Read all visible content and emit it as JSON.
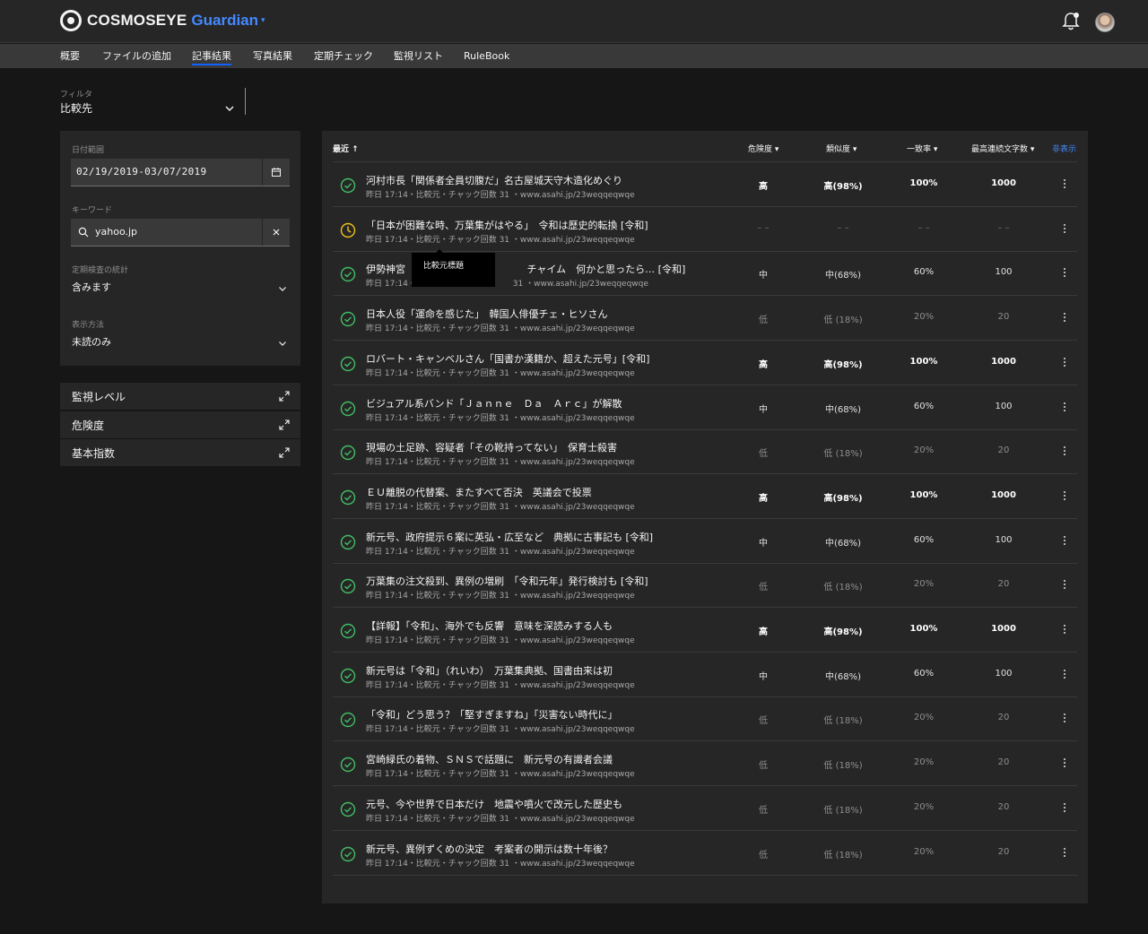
{
  "header": {
    "brand": "COSMOSEYE",
    "product": "Guardian",
    "product_caret": "▾"
  },
  "nav": {
    "items": [
      {
        "label": "概要",
        "active": false
      },
      {
        "label": "ファイルの追加",
        "active": false
      },
      {
        "label": "記事結果",
        "active": true
      },
      {
        "label": "写真結果",
        "active": false
      },
      {
        "label": "定期チェック",
        "active": false
      },
      {
        "label": "監視リスト",
        "active": false
      },
      {
        "label": "RuleBook",
        "active": false
      }
    ]
  },
  "filter": {
    "label": "フィルタ",
    "value": "比較先"
  },
  "filter_card": {
    "date_label": "日付範囲",
    "date_value": "02/19/2019-03/07/2019",
    "keyword_label": "キーワード",
    "keyword_value": "yahoo.jp",
    "stats_label": "定期検査の統計",
    "stats_value": "含みます",
    "display_label": "表示方法",
    "display_value": "未読のみ"
  },
  "accordions": [
    "監視レベル",
    "危険度",
    "基本指数"
  ],
  "table": {
    "col_recent": "最近 ↑",
    "col_risk": "危険度 ▾",
    "col_similarity": "類似度 ▾",
    "col_match": "一致率 ▾",
    "col_maxchars": "最高連続文字数 ▾",
    "hide": "非表示",
    "tooltip": "比較元標題",
    "rows": [
      {
        "status": "done",
        "title": "河村市長「関係者全員切腹だ」名古屋城天守木造化めぐり",
        "meta": "昨日 17:14・比較元・チャック回数 31 ・www.asahi.jp/23weqqeqwqe",
        "risk": "高",
        "similarity": "高(98%)",
        "match": "100%",
        "maxchars": "1000",
        "level": "hi"
      },
      {
        "status": "pending",
        "title": "「日本が困難な時、万葉集がはやる」　令和は歴史的転換 [令和]",
        "meta": "昨日 17:14・比較元・チャック回数 31 ・www.asahi.jp/23weqqeqwqe",
        "risk": "– –",
        "similarity": "– –",
        "match": "– –",
        "maxchars": "– –",
        "level": "na"
      },
      {
        "status": "done",
        "title": "伊勢神宮 　　　　　　　　　　　　チャイム　何かと思ったら… [令和]",
        "meta": "昨日 17:14・　　　　　　　　　　　　31 ・www.asahi.jp/23weqqeqwqe",
        "risk": "中",
        "similarity": "中(68%)",
        "match": "60%",
        "maxchars": "100",
        "level": "md"
      },
      {
        "status": "done",
        "title": "日本人役「運命を感じた」　韓国人俳優チェ・ヒソさん",
        "meta": "昨日 17:14・比較元・チャック回数 31 ・www.asahi.jp/23weqqeqwqe",
        "risk": "低",
        "similarity": "低 (18%)",
        "match": "20%",
        "maxchars": "20",
        "level": "lo"
      },
      {
        "status": "done",
        "title": "ロバート・キャンベルさん「国書か漢籍か、超えた元号」[令和]",
        "meta": "昨日 17:14・比較元・チャック回数 31 ・www.asahi.jp/23weqqeqwqe",
        "risk": "高",
        "similarity": "高(98%)",
        "match": "100%",
        "maxchars": "1000",
        "level": "hi"
      },
      {
        "status": "done",
        "title": "ビジュアル系バンド「Ｊａｎｎｅ　Ｄａ　Ａｒｃ」が解散",
        "meta": "昨日 17:14・比較元・チャック回数 31 ・www.asahi.jp/23weqqeqwqe",
        "risk": "中",
        "similarity": "中(68%)",
        "match": "60%",
        "maxchars": "100",
        "level": "md"
      },
      {
        "status": "done",
        "title": "現場の土足跡、容疑者「その靴持ってない」　保育士殺害",
        "meta": "昨日 17:14・比較元・チャック回数 31 ・www.asahi.jp/23weqqeqwqe",
        "risk": "低",
        "similarity": "低 (18%)",
        "match": "20%",
        "maxchars": "20",
        "level": "lo"
      },
      {
        "status": "done",
        "title": "ＥＵ離脱の代替案、またすべて否決　英議会で投票",
        "meta": "昨日 17:14・比較元・チャック回数 31 ・www.asahi.jp/23weqqeqwqe",
        "risk": "高",
        "similarity": "高(98%)",
        "match": "100%",
        "maxchars": "1000",
        "level": "hi"
      },
      {
        "status": "done",
        "title": "新元号、政府提示６案に英弘・広至など　典拠に古事記も [令和]",
        "meta": "昨日 17:14・比較元・チャック回数 31 ・www.asahi.jp/23weqqeqwqe",
        "risk": "中",
        "similarity": "中(68%)",
        "match": "60%",
        "maxchars": "100",
        "level": "md"
      },
      {
        "status": "done",
        "title": "万葉集の注文殺到、異例の増刷　「令和元年」発行検討も [令和]",
        "meta": "昨日 17:14・比較元・チャック回数 31 ・www.asahi.jp/23weqqeqwqe",
        "risk": "低",
        "similarity": "低 (18%)",
        "match": "20%",
        "maxchars": "20",
        "level": "lo"
      },
      {
        "status": "done",
        "title": "【詳報】「令和」、海外でも反響　意味を深読みする人も",
        "meta": "昨日 17:14・比較元・チャック回数 31 ・www.asahi.jp/23weqqeqwqe",
        "risk": "高",
        "similarity": "高(98%)",
        "match": "100%",
        "maxchars": "1000",
        "level": "hi"
      },
      {
        "status": "done",
        "title": "新元号は「令和」（れいわ）　万葉集典拠、国書由来は初",
        "meta": "昨日 17:14・比較元・チャック回数 31 ・www.asahi.jp/23weqqeqwqe",
        "risk": "中",
        "similarity": "中(68%)",
        "match": "60%",
        "maxchars": "100",
        "level": "md"
      },
      {
        "status": "done",
        "title": "「令和」どう思う？「堅すぎますね」「災害ない時代に」",
        "meta": "昨日 17:14・比較元・チャック回数 31 ・www.asahi.jp/23weqqeqwqe",
        "risk": "低",
        "similarity": "低 (18%)",
        "match": "20%",
        "maxchars": "20",
        "level": "lo"
      },
      {
        "status": "done",
        "title": "宮崎緑氏の着物、ＳＮＳで話題に　新元号の有識者会議",
        "meta": "昨日 17:14・比較元・チャック回数 31 ・www.asahi.jp/23weqqeqwqe",
        "risk": "低",
        "similarity": "低 (18%)",
        "match": "20%",
        "maxchars": "20",
        "level": "lo"
      },
      {
        "status": "done",
        "title": "元号、今や世界で日本だけ　地震や噴火で改元した歴史も",
        "meta": "昨日 17:14・比較元・チャック回数 31 ・www.asahi.jp/23weqqeqwqe",
        "risk": "低",
        "similarity": "低 (18%)",
        "match": "20%",
        "maxchars": "20",
        "level": "lo"
      },
      {
        "status": "done",
        "title": "新元号、異例ずくめの決定　考案者の開示は数十年後？",
        "meta": "昨日 17:14・比較元・チャック回数 31 ・www.asahi.jp/23weqqeqwqe",
        "risk": "低",
        "similarity": "低 (18%)",
        "match": "20%",
        "maxchars": "20",
        "level": "lo"
      }
    ]
  },
  "colors": {
    "accent": "#4589ff",
    "active_underline": "#0f62fe",
    "status_done": "#42be65",
    "status_pending": "#f1c21b"
  },
  "icons": {
    "logo": "cosmoseye-logo-icon",
    "bell": "notification-bell-icon",
    "calendar": "calendar-icon",
    "search": "search-icon",
    "clear": "close-icon",
    "chevron": "chevron-down-icon",
    "expand": "maximize-icon",
    "done": "checkmark-outline-icon",
    "pending": "time-icon",
    "overflow": "overflow-menu-vertical-icon"
  }
}
